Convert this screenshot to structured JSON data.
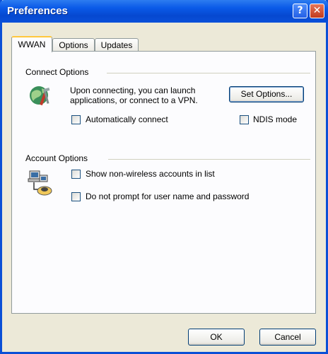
{
  "window": {
    "title": "Preferences"
  },
  "titlebar": {
    "help_glyph": "?",
    "close_glyph": "✕"
  },
  "tabs": [
    {
      "label": "WWAN",
      "active": true
    },
    {
      "label": "Options",
      "active": false
    },
    {
      "label": "Updates",
      "active": false
    }
  ],
  "connect_options": {
    "group_label": "Connect Options",
    "description_line1": "Upon connecting, you can launch",
    "description_line2": "applications, or connect to a VPN.",
    "set_options_button": "Set Options...",
    "auto_connect_label": "Automatically connect",
    "auto_connect_checked": false,
    "ndis_mode_label": "NDIS mode",
    "ndis_mode_checked": false,
    "icon": "globe-tools-icon"
  },
  "account_options": {
    "group_label": "Account Options",
    "show_non_wireless_label": "Show non-wireless accounts in list",
    "show_non_wireless_checked": false,
    "no_prompt_label": "Do not prompt for user name and password",
    "no_prompt_checked": false,
    "icon": "network-accounts-icon"
  },
  "footer": {
    "ok_label": "OK",
    "cancel_label": "Cancel"
  },
  "colors": {
    "titlebar": "#0a5ae8",
    "dialog_bg": "#ece9d8",
    "panel_bg": "#fcfcfe",
    "tab_highlight": "#ffc83c"
  }
}
